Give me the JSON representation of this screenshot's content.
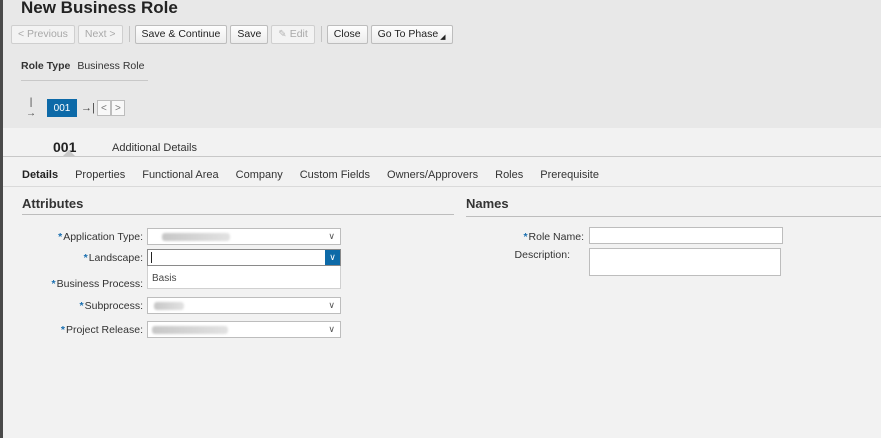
{
  "header": {
    "title": "New Business Role"
  },
  "toolbar": {
    "previous_label": "< Previous",
    "next_label": "Next >",
    "save_continue_label": "Save & Continue",
    "save_label": "Save",
    "edit_label": "Edit",
    "close_label": "Close",
    "go_to_phase_label": "Go To Phase"
  },
  "role_type": {
    "label": "Role Type",
    "value": "Business Role"
  },
  "pager": {
    "first_icon": "first-page-icon",
    "current": "001",
    "prev_label": "<",
    "next_label": ">"
  },
  "section_tabs": {
    "main": "001",
    "additional": "Additional Details"
  },
  "sub_tabs": [
    "Details",
    "Properties",
    "Functional Area",
    "Company",
    "Custom Fields",
    "Owners/Approvers",
    "Roles",
    "Prerequisite"
  ],
  "attributes": {
    "heading": "Attributes",
    "application_type_label": "Application Type:",
    "landscape_label": "Landscape:",
    "business_process_label": "Business Process:",
    "subprocess_label": "Subprocess:",
    "project_release_label": "Project Release:",
    "dropdown_partial_text": "Basis"
  },
  "names": {
    "heading": "Names",
    "role_name_label": "Role Name:",
    "description_label": "Description:"
  },
  "colors": {
    "accent": "#0d6aa8",
    "required_star": "#1a6fb0"
  },
  "required_marker": "*"
}
